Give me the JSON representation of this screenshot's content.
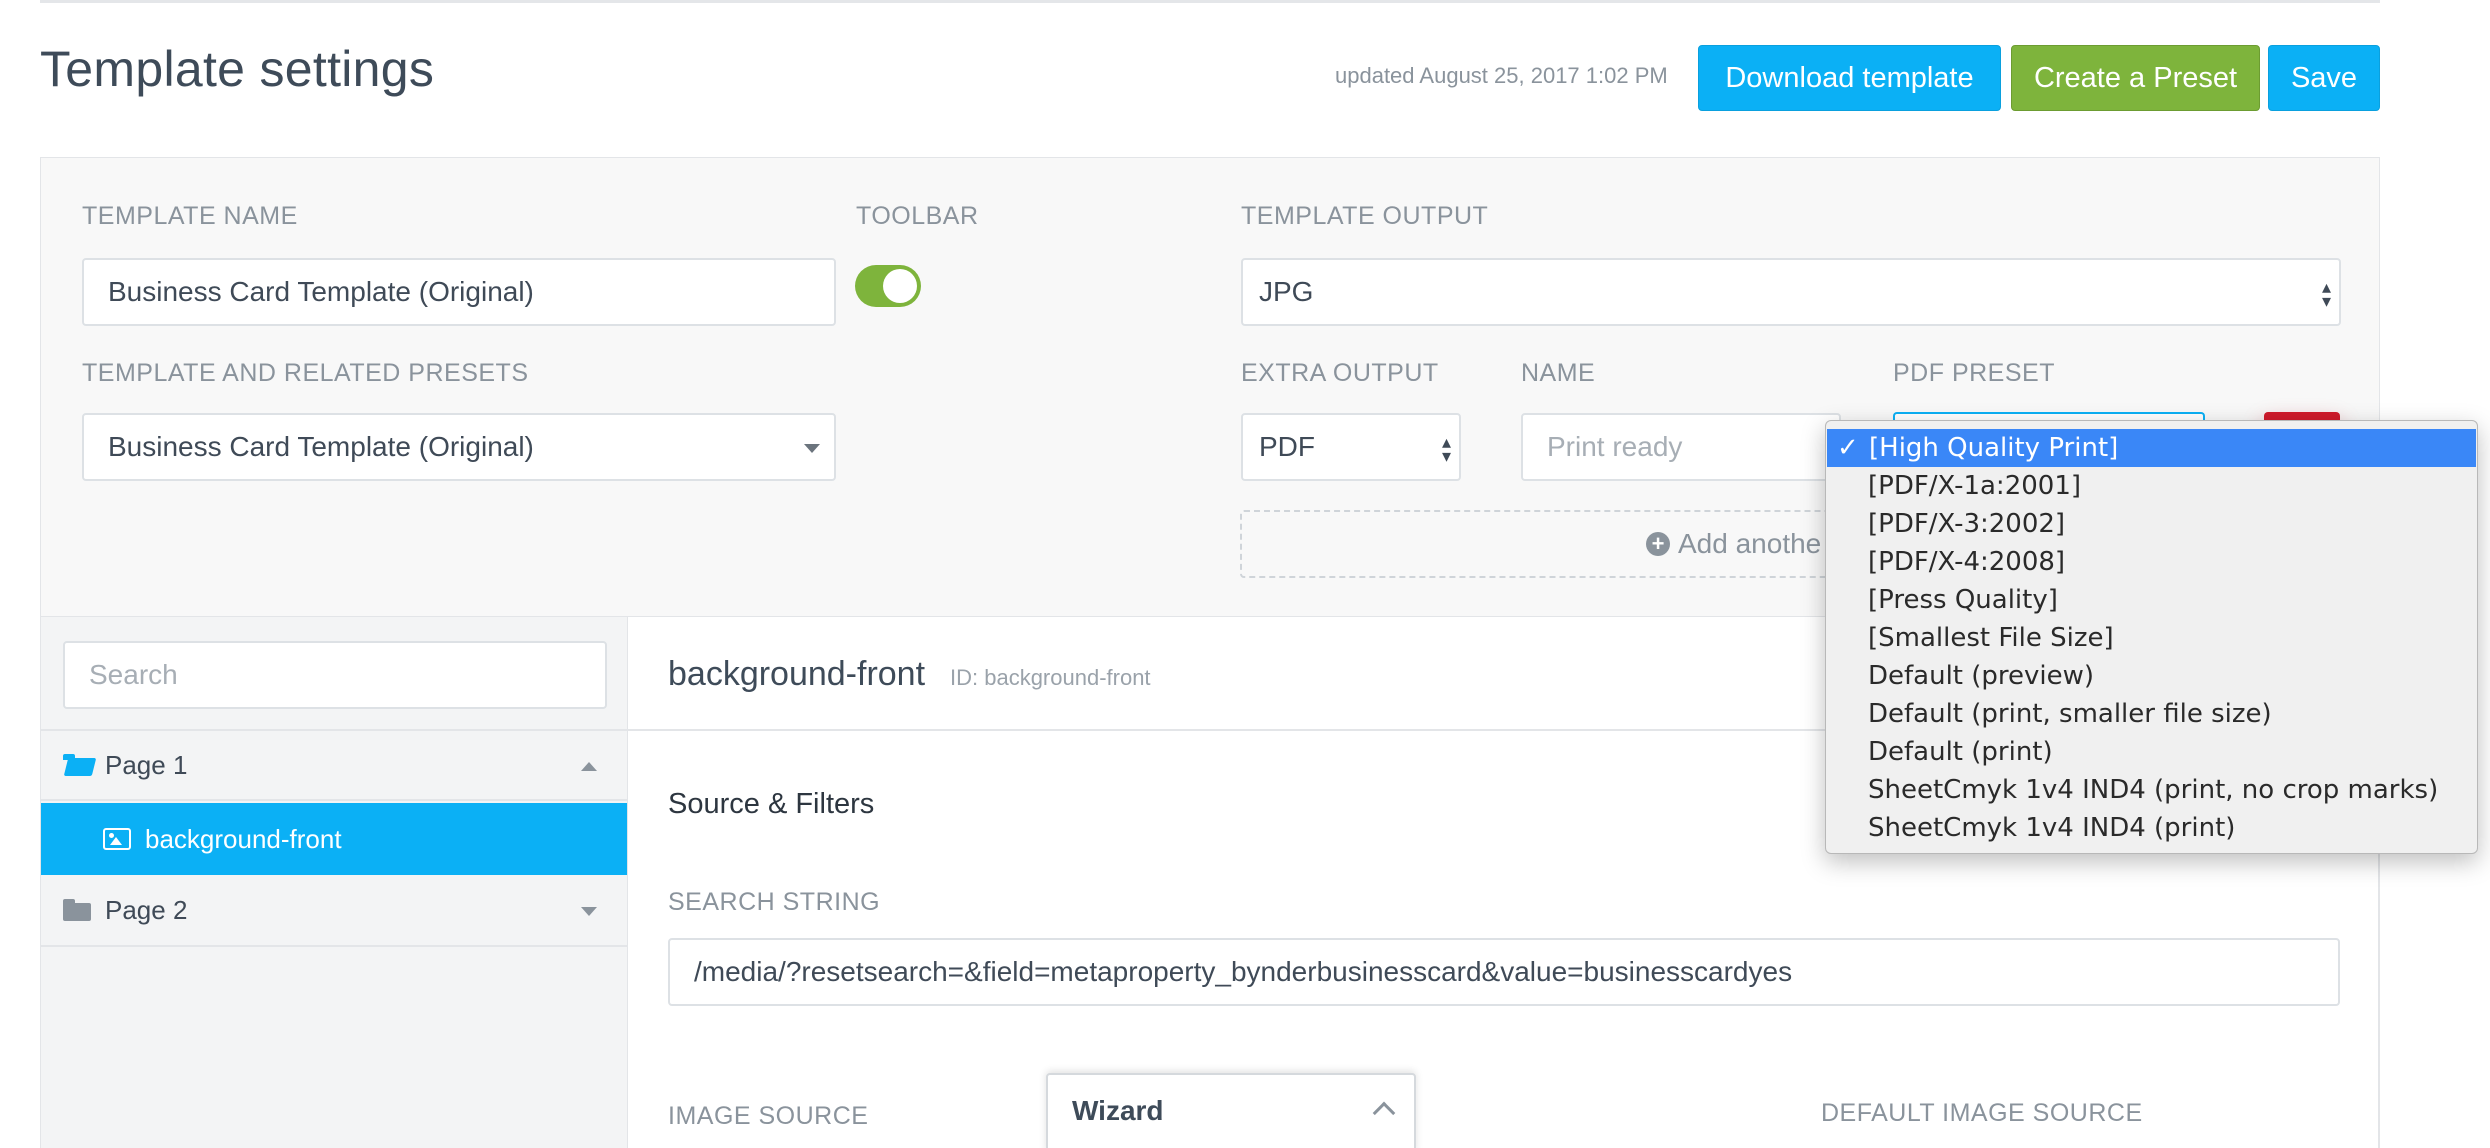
{
  "header": {
    "title": "Template settings",
    "updated": "updated August 25, 2017 1:02 PM",
    "download_label": "Download template",
    "preset_label": "Create a Preset",
    "save_label": "Save"
  },
  "settings": {
    "template_name_label": "TEMPLATE NAME",
    "template_name_value": "Business Card Template (Original)",
    "toolbar_label": "TOOLBAR",
    "toolbar_on": true,
    "template_output_label": "TEMPLATE OUTPUT",
    "template_output_value": "JPG",
    "related_presets_label": "TEMPLATE AND RELATED PRESETS",
    "related_presets_value": "Business Card Template (Original)",
    "extra_output_label": "EXTRA OUTPUT",
    "extra_output_value": "PDF",
    "name_label": "NAME",
    "name_placeholder": "Print ready",
    "pdf_preset_label": "PDF PRESET",
    "add_another_label": "Add anothe"
  },
  "sidebar": {
    "search_placeholder": "Search",
    "items": [
      {
        "label": "Page 1",
        "expanded": true
      },
      {
        "label": "background-front",
        "selected": true
      },
      {
        "label": "Page 2",
        "expanded": false
      }
    ]
  },
  "main": {
    "element_title": "background-front",
    "element_id": "ID: background-front",
    "section_title": "Source & Filters",
    "search_string_label": "SEARCH STRING",
    "search_string_value": "/media/?resetsearch=&field=metaproperty_bynderbusinesscard&value=businesscardyes",
    "image_source_label": "IMAGE SOURCE",
    "default_image_source_label": "DEFAULT IMAGE SOURCE"
  },
  "wizard": {
    "title": "Wizard"
  },
  "pdf_preset_dropdown": {
    "selected_index": 0,
    "check": "✓",
    "options": [
      "[High Quality Print]",
      "[PDF/X-1a:2001]",
      "[PDF/X-3:2002]",
      "[PDF/X-4:2008]",
      "[Press Quality]",
      "[Smallest File Size]",
      "Default (preview)",
      "Default (print, smaller file size)",
      "Default (print)",
      "SheetCmyk 1v4 IND4 (print, no crop marks)",
      "SheetCmyk 1v4 IND4 (print)"
    ]
  },
  "colors": {
    "primary_blue": "#0bb0f5",
    "success_green": "#7eb43c",
    "danger_red": "#cf1a2b",
    "menu_highlight": "#3a87f7"
  }
}
